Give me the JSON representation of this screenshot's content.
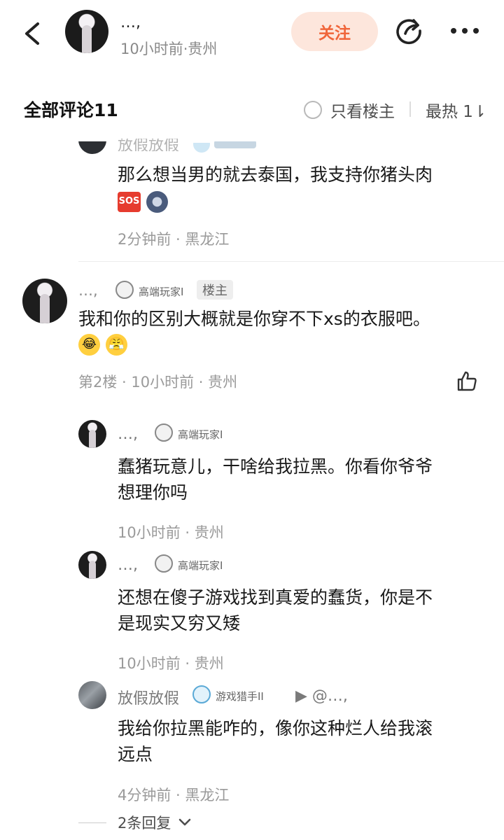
{
  "header": {
    "name": "…,",
    "meta": "10小时前·贵州",
    "follow_label": "关注"
  },
  "section": {
    "title": "全部评论11",
    "only_host_label": "只看楼主",
    "sort_label": "最热 1⇂"
  },
  "partial_comment": {
    "name": "放假放假",
    "text_line1": "那么想当男的就去泰国，我支持你猪头肉",
    "emojis": [
      "sos",
      "moon"
    ],
    "meta": "2分钟前 · 黑龙江"
  },
  "main_comment": {
    "name": "…,",
    "badge_label": "高端玩家I",
    "host_tag": "楼主",
    "text": "我和你的区别大概就是你穿不下xs的衣服吧。",
    "emojis": [
      "laugh",
      "huff"
    ],
    "meta": "第2楼 · 10小时前 · 贵州"
  },
  "replies": [
    {
      "name": "…,",
      "badge_label": "高端玩家I",
      "line1": "蠢猪玩意儿，干啥给我拉黑。你看你爷爷",
      "line2": "想理你吗",
      "meta": "10小时前 · 贵州"
    },
    {
      "name": "…,",
      "badge_label": "高端玩家I",
      "line1": "还想在傻子游戏找到真爱的蠢货，你是不",
      "line2": "是现实又穷又矮",
      "meta": "10小时前 · 贵州"
    },
    {
      "name": "放假放假",
      "badge_label": "游戏猎手II",
      "reply_to": "▶ @…,",
      "line1": "我给你拉黑能咋的，像你这种烂人给我滚",
      "line2": "远点",
      "meta": "4分钟前 · 黑龙江"
    }
  ],
  "more_replies_label": "2条回复"
}
